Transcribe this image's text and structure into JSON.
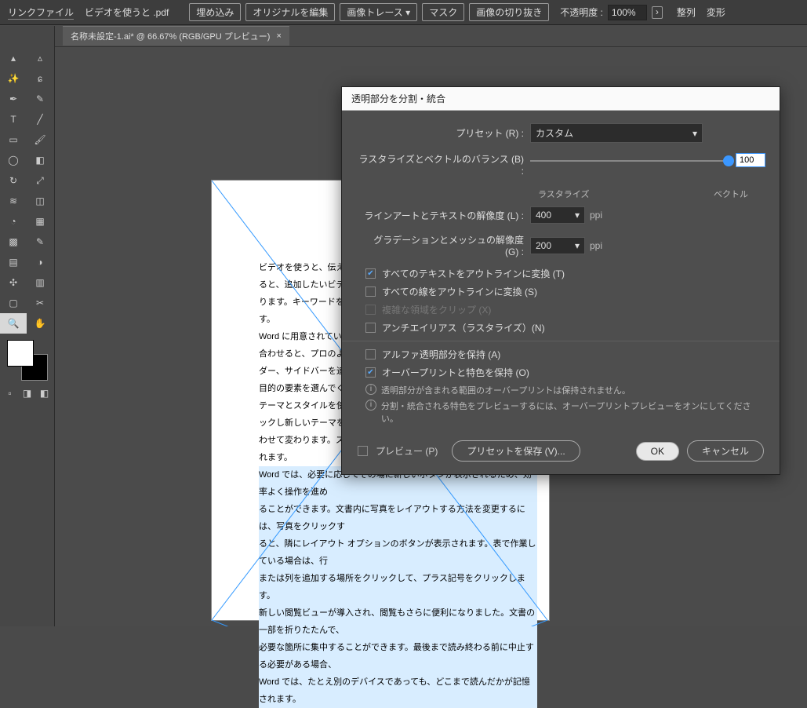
{
  "topbar": {
    "linkfile": "リンクファイル",
    "filename": "ビデオを使うと .pdf",
    "embed": "埋め込み",
    "editOriginal": "オリジナルを編集",
    "imageTrace": "画像トレース",
    "mask": "マスク",
    "crop": "画像の切り抜き",
    "opacityLabel": "不透明度 :",
    "opacityValue": "100%",
    "arrange": "整列",
    "transform": "変形"
  },
  "tab": {
    "label": "名称未設定-1.ai* @ 66.67% (RGB/GPU プレビュー)",
    "close": "×"
  },
  "doc": {
    "lines": [
      "ビデオを使うと、伝えたい",
      "ると、追加したいビデオを",
      "ります。キーワードを入力",
      "す。",
      "Word に用意されている",
      "合わせると、プロのような",
      "ダー、サイドバーを追加",
      "目的の要素を選んでくださ",
      "テーマとスタイルを使っ",
      "ックし新しいテーマを選",
      "わせて変わります。スタ",
      "れます。"
    ],
    "hl_lines": [
      "Word では、必要に応じてその場に新しいボタンが表示されるため、効率よく操作を進め",
      "ることができます。文書内に写真をレイアウトする方法を変更するには、写真をクリックす",
      "ると、隣にレイアウト オプションのボタンが表示されます。表で作業している場合は、行",
      "または列を追加する場所をクリックして、プラス記号をクリックします。",
      "新しい閲覧ビューが導入され、閲覧もさらに便利になりました。文書の一部を折りたたんで、",
      "必要な箇所に集中することができます。最後まで読み終わる前に中止する必要がある場合、",
      "Word では、たとえ別のデバイスであっても、どこまで読んだかが記憶されます。"
    ]
  },
  "dialog": {
    "title": "透明部分を分割・統合",
    "presetLabel": "プリセット (R) :",
    "presetValue": "カスタム",
    "balanceLabel": "ラスタライズとベクトルのバランス (B) :",
    "balanceValue": "100",
    "balanceLeft": "ラスタライズ",
    "balanceRight": "ベクトル",
    "lineartLabel": "ラインアートとテキストの解像度 (L) :",
    "lineartValue": "400",
    "gradLabel": "グラデーションとメッシュの解像度 (G) :",
    "gradValue": "200",
    "ppi": "ppi",
    "cb_textOutline": "すべてのテキストをアウトラインに変換 (T)",
    "cb_strokeOutline": "すべての線をアウトラインに変換 (S)",
    "cb_clipComplex": "複雑な領域をクリップ (X)",
    "cb_antialias": "アンチエイリアス（ラスタライズ）(N)",
    "cb_alpha": "アルファ透明部分を保持 (A)",
    "cb_overprint": "オーバープリントと特色を保持 (O)",
    "info1": "透明部分が含まれる範囲のオーバープリントは保持されません。",
    "info2": "分割・統合される特色をプレビューするには、オーバープリントプレビューをオンにしてください。",
    "previewLabel": "プレビュー (P)",
    "savePreset": "プリセットを保存 (V)...",
    "ok": "OK",
    "cancel": "キャンセル"
  }
}
